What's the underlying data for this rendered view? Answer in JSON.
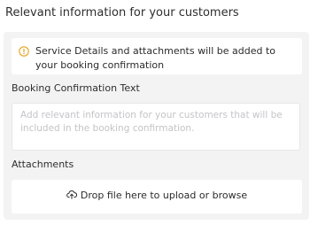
{
  "section": {
    "title": "Relevant information for your customers"
  },
  "info": {
    "icon": "info-circle-icon",
    "icon_color": "#e8a21c",
    "text": "Service Details and attachments will be added to your booking confirmation"
  },
  "booking_text": {
    "label": "Booking Confirmation Text",
    "value": "",
    "placeholder": "Add relevant information for your customers that will be included in the booking confirmation."
  },
  "attachments": {
    "label": "Attachments",
    "icon": "cloud-upload-icon",
    "dropzone_text": "Drop file here to upload or browse"
  }
}
